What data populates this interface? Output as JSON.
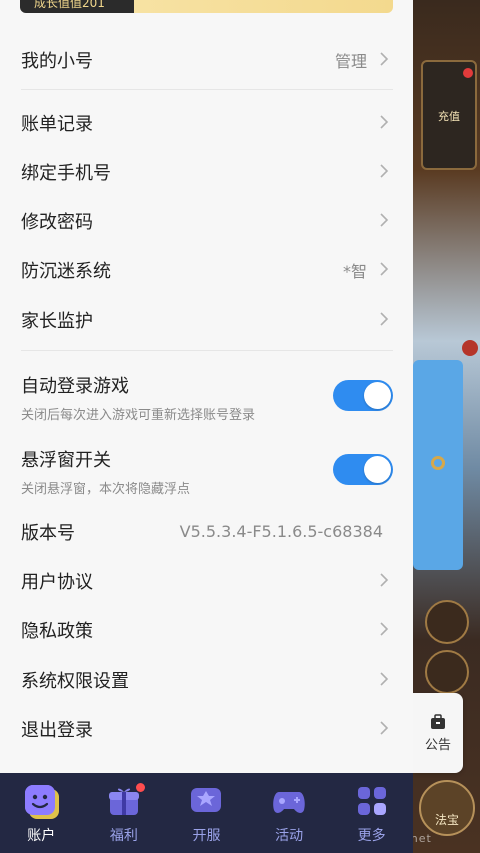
{
  "growth_banner": "成长值值201",
  "menu": {
    "sub_account": {
      "label": "我的小号",
      "value": "管理"
    },
    "items_a": [
      {
        "label": "账单记录"
      },
      {
        "label": "绑定手机号"
      },
      {
        "label": "修改密码"
      },
      {
        "label": "防沉迷系统",
        "value": "*智"
      },
      {
        "label": "家长监护"
      }
    ],
    "toggles": [
      {
        "label": "自动登录游戏",
        "sub": "关闭后每次进入游戏可重新选择账号登录",
        "on": true
      },
      {
        "label": "悬浮窗开关",
        "sub": "关闭悬浮窗，本次将隐藏浮点",
        "on": true
      }
    ],
    "version": {
      "label": "版本号",
      "value": "V5.5.3.4-F5.1.6.5-c68384"
    },
    "items_b": [
      {
        "label": "用户协议"
      },
      {
        "label": "隐私政策"
      },
      {
        "label": "系统权限设置"
      },
      {
        "label": "退出登录"
      }
    ]
  },
  "bottom_nav": [
    {
      "label": "账户",
      "icon": "account-icon",
      "active": true
    },
    {
      "label": "福利",
      "icon": "gift-icon",
      "badge": true
    },
    {
      "label": "开服",
      "icon": "server-icon"
    },
    {
      "label": "活动",
      "icon": "gamepad-icon"
    },
    {
      "label": "更多",
      "icon": "more-icon"
    }
  ],
  "game": {
    "badge_text": "充值",
    "notice_label": "公告",
    "fabao_label": "法宝",
    "watermark": "kkx.net"
  },
  "colors": {
    "accent": "#2f8cf0",
    "nav_bg": "#232843",
    "nav_label": "#9aa2e8"
  }
}
